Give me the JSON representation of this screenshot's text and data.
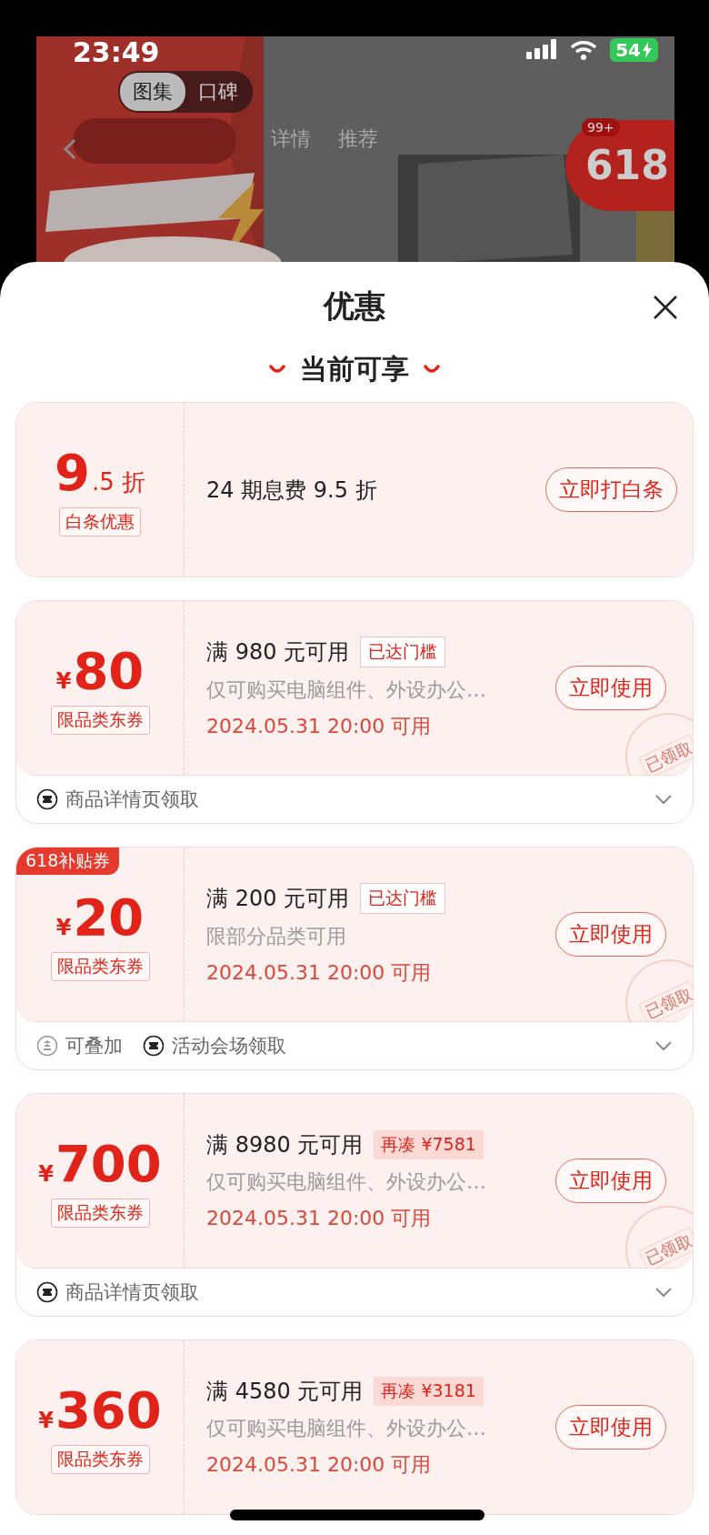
{
  "status_bar": {
    "time": "23:49",
    "battery": "54"
  },
  "background_page": {
    "tabs": [
      {
        "label": "图集",
        "selected": true
      },
      {
        "label": "口碑",
        "selected": false
      }
    ],
    "nav": [
      {
        "label": "详情"
      },
      {
        "label": "推荐"
      }
    ],
    "promo_badge": {
      "label": "618",
      "count": "99+"
    }
  },
  "sheet": {
    "title": "优惠",
    "section": "当前可享"
  },
  "offers": [
    {
      "kind": "discount",
      "value_main": "9",
      "value_sub": ".5 折",
      "tag": "白条优惠",
      "title": "24 期息费 9.5 折",
      "button": "立即打白条"
    },
    {
      "kind": "coupon",
      "currency": "¥",
      "amount": "80",
      "tag": "限品类东券",
      "title": "满 980 元可用",
      "status": {
        "kind": "reached",
        "label": "已达门槛"
      },
      "description": "仅可购买电脑组件、外设办公…",
      "date": "2024.05.31 20:00 可用",
      "button": "立即使用",
      "stamp": "已领取",
      "footer": [
        {
          "kind": "ticket",
          "label": "商品详情页领取"
        }
      ]
    },
    {
      "kind": "coupon",
      "ribbon": "618补贴券",
      "currency": "¥",
      "amount": "20",
      "tag": "限品类东券",
      "title": "满 200 元可用",
      "status": {
        "kind": "reached",
        "label": "已达门槛"
      },
      "description": "限部分品类可用",
      "date": "2024.05.31 20:00 可用",
      "button": "立即使用",
      "stamp": "已领取",
      "footer": [
        {
          "kind": "stack",
          "label": "可叠加"
        },
        {
          "kind": "ticket",
          "label": "活动会场领取"
        }
      ]
    },
    {
      "kind": "coupon",
      "currency": "¥",
      "amount": "700",
      "tag": "限品类东券",
      "title": "满 8980 元可用",
      "status": {
        "kind": "shortfall",
        "label": "再凑 ¥7581"
      },
      "description": "仅可购买电脑组件、外设办公…",
      "date": "2024.05.31 20:00 可用",
      "button": "立即使用",
      "stamp": "已领取",
      "footer": [
        {
          "kind": "ticket",
          "label": "商品详情页领取"
        }
      ]
    },
    {
      "kind": "coupon",
      "currency": "¥",
      "amount": "360",
      "tag": "限品类东券",
      "title": "满 4580 元可用",
      "status": {
        "kind": "shortfall",
        "label": "再凑 ¥3181"
      },
      "description": "仅可购买电脑组件、外设办公…",
      "date": "2024.05.31 20:00 可用",
      "button": "立即使用"
    }
  ]
}
